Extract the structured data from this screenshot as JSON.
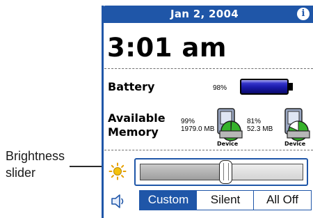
{
  "callout": {
    "label_line1": "Brightness",
    "label_line2": "slider"
  },
  "header": {
    "date": "Jan 2, 2004",
    "info_symbol": "i"
  },
  "clock": {
    "time": "3:01 am"
  },
  "battery": {
    "label": "Battery",
    "percent_text": "98%",
    "level": 0.98
  },
  "memory": {
    "label_line1": "Available",
    "label_line2": "Memory",
    "cards": [
      {
        "percent": "99%",
        "size": "1979.0 MB",
        "name": "Device"
      },
      {
        "percent": "81%",
        "size": "52.3 MB",
        "name": "Device"
      }
    ]
  },
  "brightness": {
    "icon": "sun-icon",
    "level": 0.5
  },
  "sound": {
    "icon": "speaker-icon",
    "options": [
      "Custom",
      "Silent",
      "All Off"
    ],
    "selected": "Custom"
  },
  "colors": {
    "accent": "#1f56a8",
    "battery": "#1a1aa8",
    "pie": "#35b22a"
  }
}
